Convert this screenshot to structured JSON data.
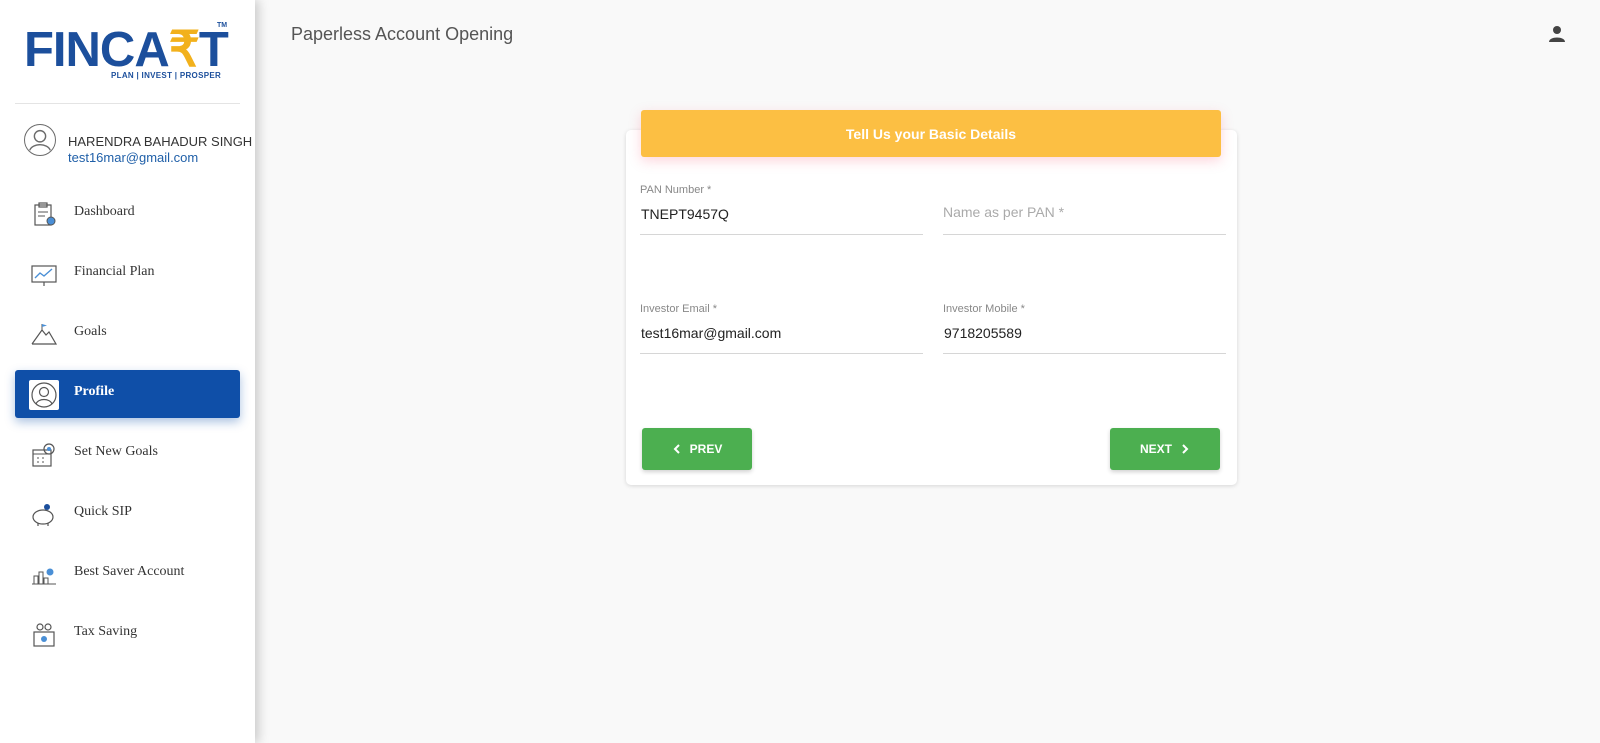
{
  "brand": {
    "logo_main": "FINCA",
    "logo_rupee": "₹",
    "logo_end": "T",
    "logo_tm": "TM",
    "tagline": "PLAN | INVEST | PROSPER",
    "primary_color": "#1c4f9c",
    "accent_color": "#f2b11c"
  },
  "user": {
    "name": "HARENDRA BAHADUR SINGH",
    "email": "test16mar@gmail.com",
    "avatar_icon": "user-circle-icon"
  },
  "sidebar": {
    "active_color": "#0f4fa8",
    "items": [
      {
        "label": "Dashboard",
        "icon": "clipboard-icon",
        "active": false
      },
      {
        "label": "Financial Plan",
        "icon": "chart-board-icon",
        "active": false
      },
      {
        "label": "Goals",
        "icon": "mountain-flag-icon",
        "active": false
      },
      {
        "label": "Profile",
        "icon": "profile-icon",
        "active": true
      },
      {
        "label": "Set New Goals",
        "icon": "target-calendar-icon",
        "active": false
      },
      {
        "label": "Quick SIP",
        "icon": "piggy-bank-icon",
        "active": false
      },
      {
        "label": "Best Saver Account",
        "icon": "city-coin-icon",
        "active": false
      },
      {
        "label": "Tax Saving",
        "icon": "tax-document-icon",
        "active": false
      }
    ]
  },
  "header": {
    "title": "Paperless Account Opening",
    "user_icon": "person-icon"
  },
  "form": {
    "heading": "Tell Us your Basic Details",
    "heading_color": "#fcbf43",
    "pan": {
      "label": "PAN Number *",
      "value": "TNEPT9457Q"
    },
    "name": {
      "placeholder": "Name as per PAN *",
      "value": ""
    },
    "email": {
      "label": "Investor Email *",
      "value": "test16mar@gmail.com"
    },
    "mobile": {
      "label": "Investor Mobile *",
      "value": "9718205589"
    },
    "prev_label": "PREV",
    "next_label": "NEXT",
    "button_color": "#4caf50"
  }
}
